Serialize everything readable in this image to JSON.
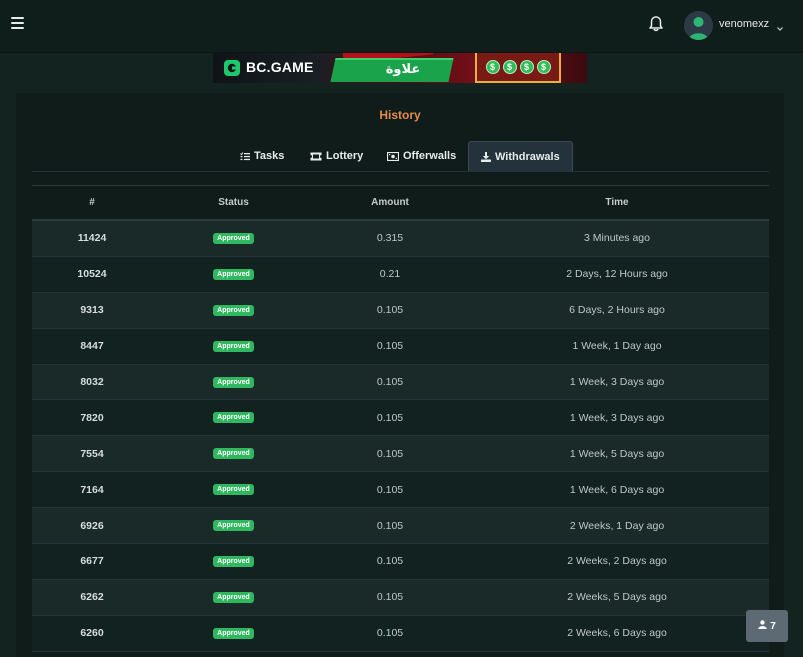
{
  "header": {
    "username": "venomexz"
  },
  "banner": {
    "brand": "BC.GAME",
    "arabic_text": "علاوة",
    "slot_symbol": "$"
  },
  "history": {
    "title": "History",
    "tabs": [
      {
        "label": "Tasks",
        "icon": "list-icon"
      },
      {
        "label": "Lottery",
        "icon": "ticket-icon"
      },
      {
        "label": "Offerwalls",
        "icon": "money-icon"
      },
      {
        "label": "Withdrawals",
        "icon": "download-icon",
        "active": true
      }
    ],
    "columns": {
      "id": "#",
      "status": "Status",
      "amount": "Amount",
      "time": "Time"
    },
    "rows": [
      {
        "id": "11424",
        "status": "Approved",
        "amount": "0.315",
        "time": "3 Minutes ago"
      },
      {
        "id": "10524",
        "status": "Approved",
        "amount": "0.21",
        "time": "2 Days, 12 Hours ago"
      },
      {
        "id": "9313",
        "status": "Approved",
        "amount": "0.105",
        "time": "6 Days, 2 Hours ago"
      },
      {
        "id": "8447",
        "status": "Approved",
        "amount": "0.105",
        "time": "1 Week, 1 Day ago"
      },
      {
        "id": "8032",
        "status": "Approved",
        "amount": "0.105",
        "time": "1 Week, 3 Days ago"
      },
      {
        "id": "7820",
        "status": "Approved",
        "amount": "0.105",
        "time": "1 Week, 3 Days ago"
      },
      {
        "id": "7554",
        "status": "Approved",
        "amount": "0.105",
        "time": "1 Week, 5 Days ago"
      },
      {
        "id": "7164",
        "status": "Approved",
        "amount": "0.105",
        "time": "1 Week, 6 Days ago"
      },
      {
        "id": "6926",
        "status": "Approved",
        "amount": "0.105",
        "time": "2 Weeks, 1 Day ago"
      },
      {
        "id": "6677",
        "status": "Approved",
        "amount": "0.105",
        "time": "2 Weeks, 2 Days ago"
      },
      {
        "id": "6262",
        "status": "Approved",
        "amount": "0.105",
        "time": "2 Weeks, 5 Days ago"
      },
      {
        "id": "6260",
        "status": "Approved",
        "amount": "0.105",
        "time": "2 Weeks, 6 Days ago"
      }
    ]
  },
  "online_users": {
    "count": "7",
    "icon": "user-icon"
  },
  "colors": {
    "background": "#132320",
    "panel": "#101c1a",
    "title_accent": "#e7894c",
    "approved_badge": "#2fb85f",
    "active_tab": "#24323c"
  }
}
